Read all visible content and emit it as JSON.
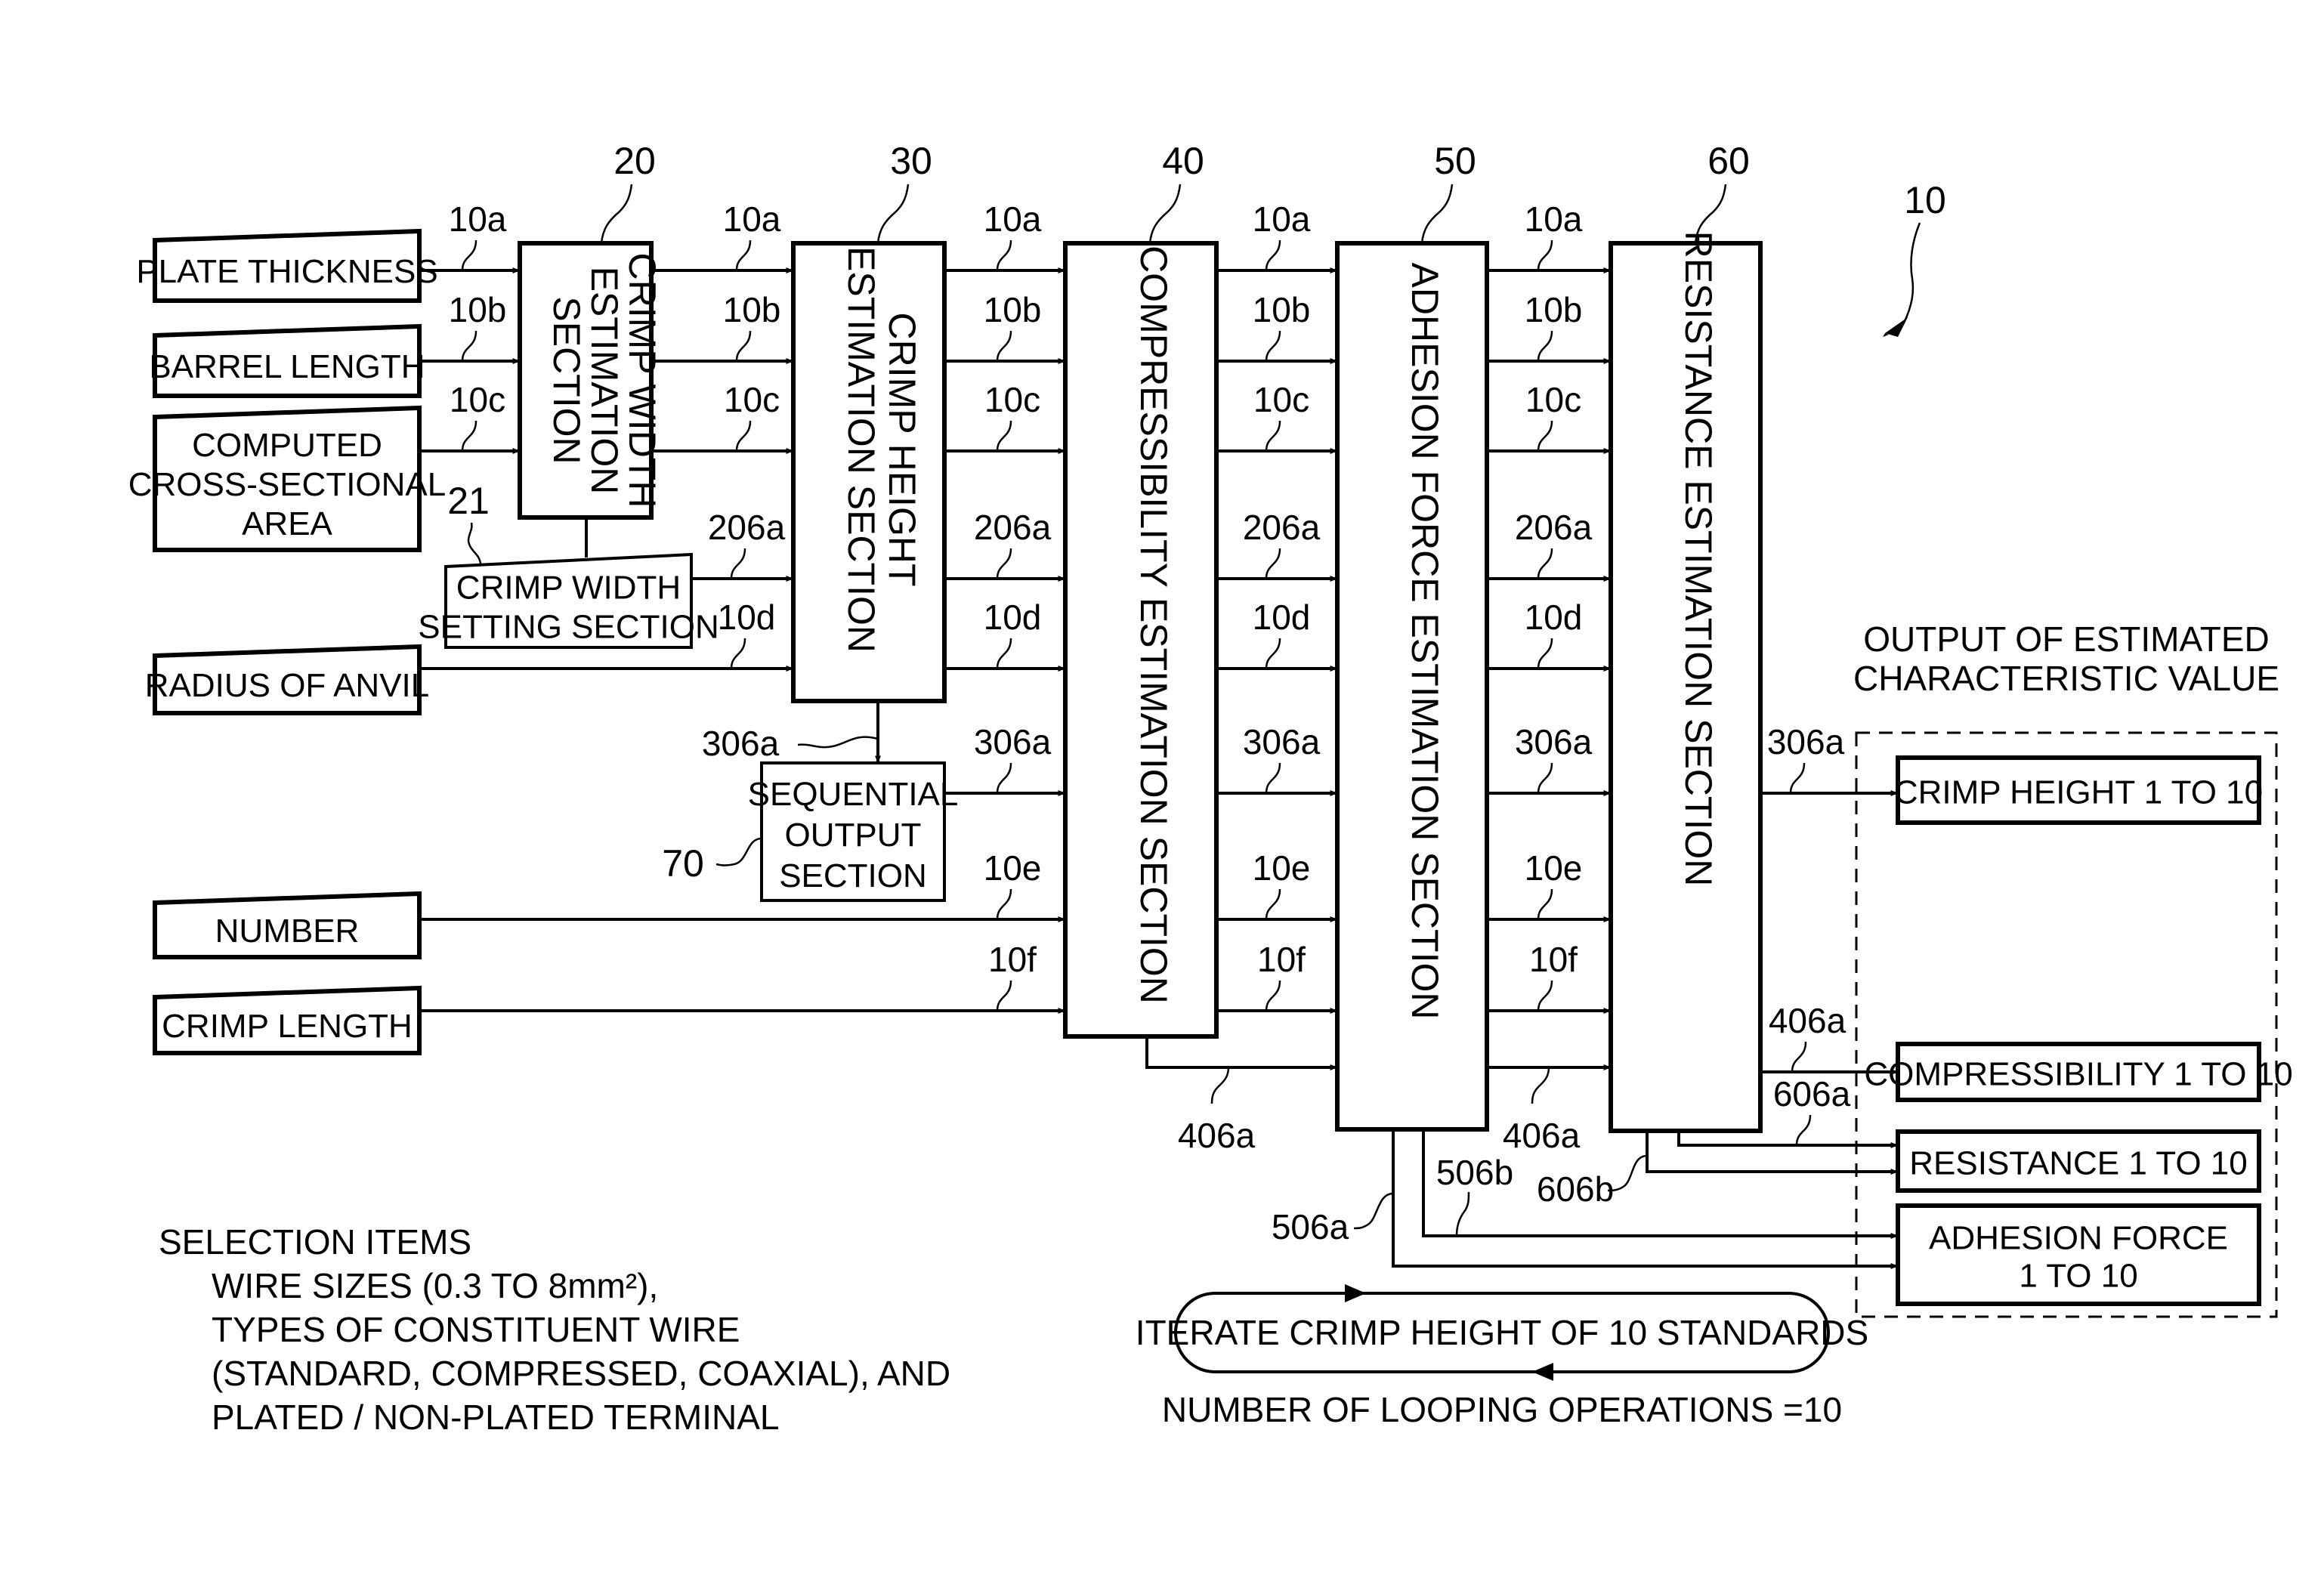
{
  "figure": {
    "reference": "10",
    "inputs": [
      {
        "id": "plate-thickness",
        "label": [
          "PLATE THICKNESS"
        ],
        "signal": "10a"
      },
      {
        "id": "barrel-length",
        "label": [
          "BARREL LENGTH"
        ],
        "signal": "10b"
      },
      {
        "id": "computed-area",
        "label": [
          "COMPUTED",
          "CROSS-SECTIONAL",
          "AREA"
        ],
        "signal": "10c"
      },
      {
        "id": "radius-of-anvil",
        "label": [
          "RADIUS OF ANVIL"
        ],
        "signal": "10d"
      },
      {
        "id": "number",
        "label": [
          "NUMBER"
        ],
        "signal": "10e"
      },
      {
        "id": "crimp-length",
        "label": [
          "CRIMP LENGTH"
        ],
        "signal": "10f"
      }
    ],
    "sections": [
      {
        "ref": "20",
        "lines": [
          "CRIMP WIDTH",
          "ESTIMATION",
          "SECTION"
        ]
      },
      {
        "ref": "21",
        "lines": [
          "CRIMP WIDTH",
          "SETTING SECTION"
        ]
      },
      {
        "ref": "30",
        "lines": [
          "CRIMP HEIGHT",
          "ESTIMATION SECTION"
        ]
      },
      {
        "ref": "70",
        "lines": [
          "SEQUENTIAL",
          "OUTPUT",
          "SECTION"
        ]
      },
      {
        "ref": "40",
        "lines": [
          "COMPRESSIBILITY ESTIMATION SECTION"
        ]
      },
      {
        "ref": "50",
        "lines": [
          "ADHESION FORCE ESTIMATION SECTION"
        ]
      },
      {
        "ref": "60",
        "lines": [
          "RESISTANCE ESTIMATION SECTION"
        ]
      }
    ],
    "signals": {
      "s10a": "10a",
      "s10b": "10b",
      "s10c": "10c",
      "s10d": "10d",
      "s10e": "10e",
      "s10f": "10f",
      "s206a": "206a",
      "s306a": "306a",
      "s406a": "406a",
      "s506a": "506a",
      "s506b": "506b",
      "s606a": "606a",
      "s606b": "606b"
    },
    "output": {
      "title": [
        "OUTPUT OF ESTIMATED",
        "CHARACTERISTIC VALUE"
      ],
      "items": [
        {
          "lines": [
            "CRIMP HEIGHT 1 TO 10"
          ]
        },
        {
          "lines": [
            "COMPRESSIBILITY 1 TO 10"
          ]
        },
        {
          "lines": [
            "RESISTANCE 1 TO 10"
          ]
        },
        {
          "lines": [
            "ADHESION FORCE",
            "1 TO 10"
          ]
        }
      ]
    },
    "loop": {
      "label": "ITERATE CRIMP HEIGHT OF 10 STANDARDS",
      "count_text": "NUMBER OF LOOPING OPERATIONS =10"
    },
    "selection": {
      "heading": "SELECTION ITEMS",
      "lines": [
        "WIRE SIZES (0.3 TO 8mm²),",
        "TYPES OF CONSTITUENT WIRE",
        "(STANDARD, COMPRESSED, COAXIAL), AND",
        "PLATED / NON-PLATED TERMINAL"
      ]
    }
  }
}
